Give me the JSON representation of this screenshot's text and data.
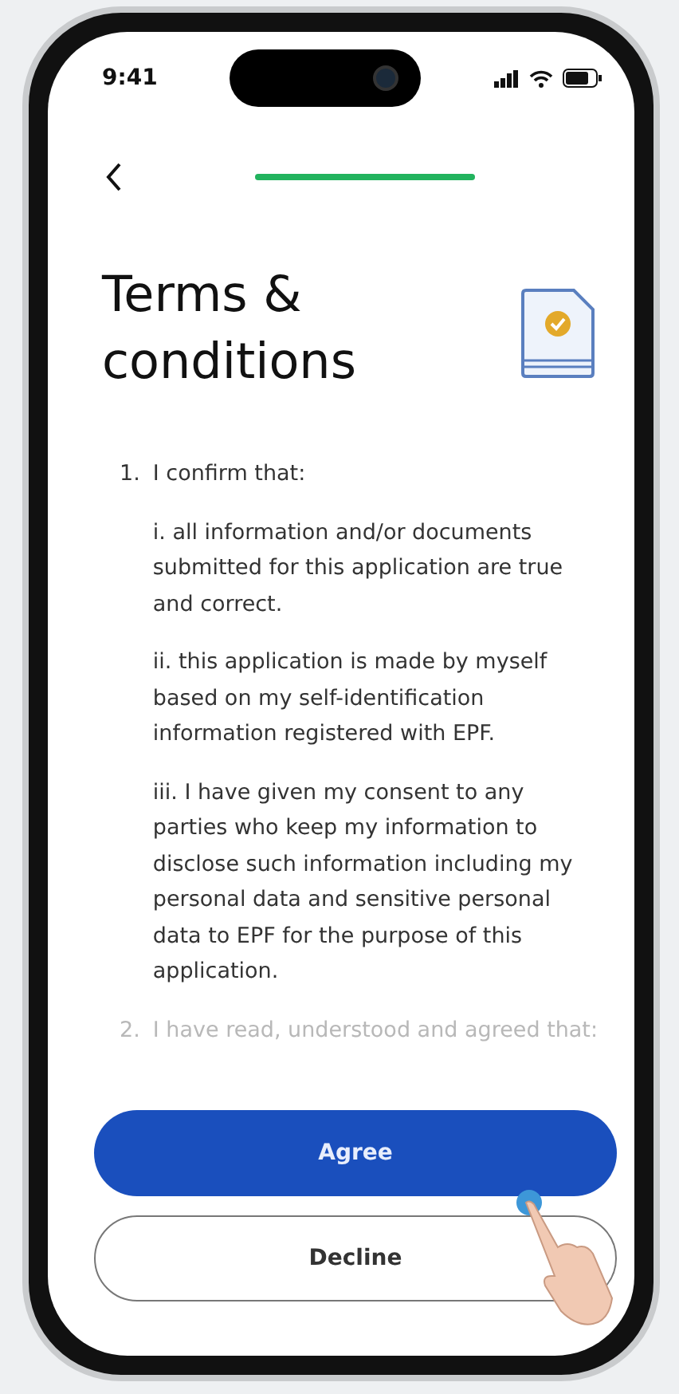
{
  "status_bar": {
    "time": "9:41"
  },
  "progress": {
    "level": 1
  },
  "title": "Terms & conditions",
  "terms": [
    {
      "number": "1.",
      "text": "I confirm that:",
      "faded": false,
      "clauses": [
        "i. all information and/or documents submitted for this application are true and correct.",
        "ii. this application is made by myself based on my self-identification information registered with EPF.",
        "iii. I have given my consent to any parties who keep my information to disclose such information including my personal data and sensitive personal data to EPF for the purpose of this application."
      ]
    },
    {
      "number": "2.",
      "text": "I have read, understood and agreed that:",
      "faded": true
    }
  ],
  "buttons": [
    {
      "label": "Agree",
      "kind": "primary"
    },
    {
      "label": "Decline",
      "kind": "secondary"
    }
  ]
}
